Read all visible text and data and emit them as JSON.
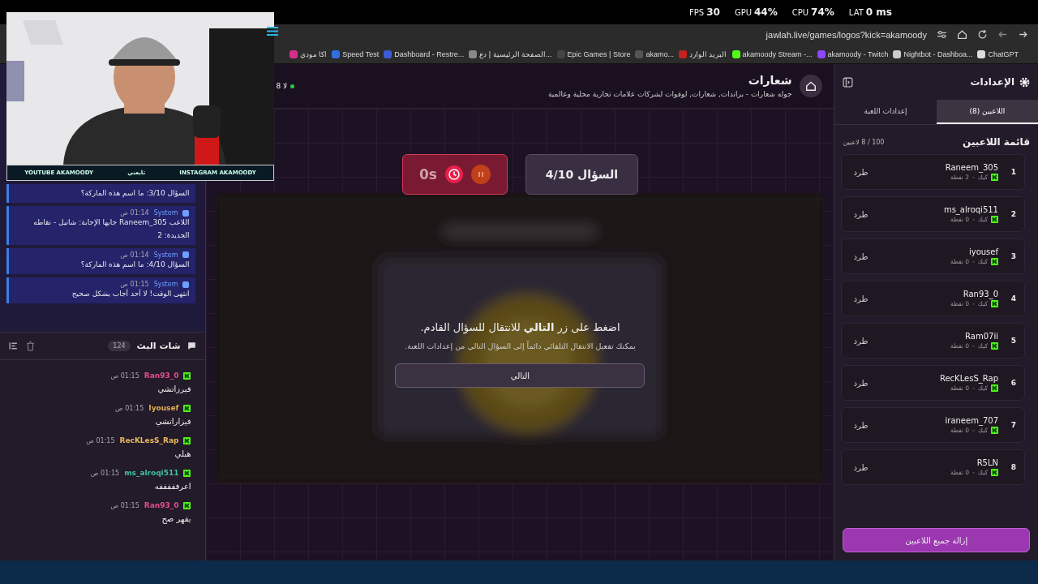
{
  "overlay_stats": [
    "LAT **0 ms**",
    "CPU **74%**",
    "GPU **44%**",
    "FPS **30**"
  ],
  "address_bar": {
    "url": "jawlah.live/games/logos?kick=akamoody"
  },
  "bookmarks": [
    {
      "label": "ChatGPT",
      "color": "#dddddd"
    },
    {
      "label": "Nightbot - Dashboa...",
      "color": "#cccccc"
    },
    {
      "label": "akamoody - Twitch",
      "color": "#9146ff"
    },
    {
      "label": "akamoody Stream -...",
      "color": "#53fc18"
    },
    {
      "label": "البريد الوارد",
      "color": "#c5221f"
    },
    {
      "label": "akamo...",
      "color": "#555555"
    },
    {
      "label": "Epic Games | Store",
      "color": "#444444"
    },
    {
      "label": "الصفحة الرئيسية | دع...",
      "color": "#888888"
    },
    {
      "label": "Dashboard - Restre...",
      "color": "#3b5bd6"
    },
    {
      "label": "Speed Test",
      "color": "#2f6fe0"
    },
    {
      "label": "اكا مودي",
      "color": "#d62f8a"
    }
  ],
  "stream_banner": [
    {
      "text": "INSTAGRAM AKAMOODY"
    },
    {
      "text": "تابعني"
    },
    {
      "text": "YOUTUBE AKAMOODY"
    }
  ],
  "system_messages": [
    {
      "text": "السؤال 3/10: ما اسم هذه الماركة؟"
    },
    {
      "author": "System",
      "time": "01:14 ص",
      "text": "اللاعب Raneem_305 جابها الإجابة: شانيل - نقاطه الجديدة: 2"
    },
    {
      "author": "System",
      "time": "01:14 ص",
      "text": "السؤال 4/10: ما اسم هذه الماركة؟"
    },
    {
      "author": "System",
      "time": "01:15 ص",
      "text": "انتهى الوقت! لا أحد أجاب بشكل صحيح"
    }
  ],
  "live_chat": {
    "title": "شات البث",
    "count": "124",
    "messages": [
      {
        "user": "Ran93_0",
        "color": "#e0508a",
        "time": "01:15 ص",
        "text": "فيرزاتشي"
      },
      {
        "user": "Iyousef",
        "color": "#e0b050",
        "time": "01:15 ص",
        "text": "فيزاراتشي"
      },
      {
        "user": "RecKLesS_Rap",
        "color": "#e8b860",
        "time": "01:15 ص",
        "text": "هبلي"
      },
      {
        "user": "ms_alroqi511",
        "color": "#40c0a0",
        "time": "01:15 ص",
        "text": "اعرفففففه"
      },
      {
        "user": "Ran93_0",
        "color": "#e0508a",
        "time": "01:15 ص",
        "text": "يقهر صح"
      }
    ]
  },
  "game": {
    "title": "شعارات",
    "subtitle": "جوله شعارات - براندات, شعارات, لوقوات لشركات علامات تجارية محلية وعالمية",
    "online": "8 لا",
    "timer": "0s",
    "question": "السؤال 4/10",
    "prompt": "اضغط على زر **التالي** للانتقال للسؤال القادم.",
    "hint": "يمكنك تفعيل الانتقال التلقائي دائماً إلى السؤال التالي من إعدادات اللعبة.",
    "next_button": "التالي"
  },
  "settings": {
    "title": "الإعدادات",
    "tabs": [
      {
        "label": "اللاعبين (8)",
        "selected": true
      },
      {
        "label": "إعدادات اللعبة",
        "selected": false
      }
    ],
    "list_title": "قائمة اللاعبين",
    "count": "100 / 8 لاعبين",
    "players": [
      {
        "rank": "1",
        "name": "Raneem_305",
        "platform": "كيك",
        "separator": "-",
        "points": "2 نقطة",
        "kick_button": "طرد"
      },
      {
        "rank": "2",
        "name": "ms_alroqi511",
        "platform": "كيك",
        "separator": "-",
        "points": "0 نقطة",
        "kick_button": "طرد"
      },
      {
        "rank": "3",
        "name": "iyousef",
        "platform": "كيك",
        "separator": "-",
        "points": "0 نقطة",
        "kick_button": "طرد"
      },
      {
        "rank": "4",
        "name": "Ran93_0",
        "platform": "كيك",
        "separator": "-",
        "points": "0 نقطة",
        "kick_button": "طرد"
      },
      {
        "rank": "5",
        "name": "Ram07ii",
        "platform": "كيك",
        "separator": "-",
        "points": "0 نقطة",
        "kick_button": "طرد"
      },
      {
        "rank": "6",
        "name": "RecKLesS_Rap",
        "platform": "كيك",
        "separator": "-",
        "points": "0 نقطة",
        "kick_button": "طرد"
      },
      {
        "rank": "7",
        "name": "iraneem_707",
        "platform": "كيك",
        "separator": "-",
        "points": "0 نقطة",
        "kick_button": "طرد"
      },
      {
        "rank": "8",
        "name": "R5LN",
        "platform": "كيك",
        "separator": "-",
        "points": "0 نقطة",
        "kick_button": "طرد"
      }
    ],
    "remove_all": "إزالة جميع اللاعبين"
  }
}
